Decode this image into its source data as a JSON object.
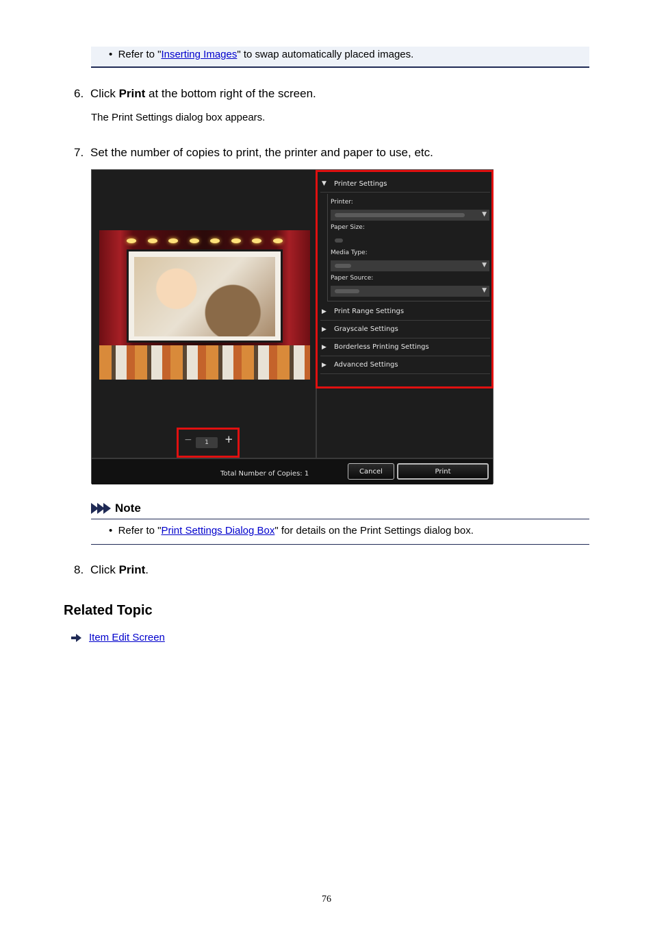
{
  "top_note": {
    "prefix": "Refer to \"",
    "link": "Inserting Images",
    "suffix": "\" to swap automatically placed images."
  },
  "step6": {
    "number": "6.",
    "before": "Click ",
    "bold": "Print",
    "after": " at the bottom right of the screen.",
    "result": "The Print Settings dialog box appears."
  },
  "step7": {
    "number": "7.",
    "text": "Set the number of copies to print, the printer and paper to use, etc."
  },
  "dialog": {
    "printer_settings_header": "Printer Settings",
    "printer_label": "Printer:",
    "paper_size_label": "Paper Size:",
    "media_type_label": "Media Type:",
    "paper_source_label": "Paper Source:",
    "sections": [
      "Print Range Settings",
      "Grayscale Settings",
      "Borderless Printing Settings",
      "Advanced Settings"
    ],
    "copies_value": "1",
    "minus": "−",
    "plus": "+",
    "total_label": "Total Number of Copies:  1",
    "cancel": "Cancel",
    "print": "Print",
    "highlight_color": "#e01010"
  },
  "note": {
    "title": "Note",
    "prefix": "Refer to \"",
    "link": "Print Settings Dialog Box",
    "suffix": "\" for details on the Print Settings dialog box."
  },
  "step8": {
    "number": "8.",
    "before": "Click ",
    "bold": "Print",
    "after": "."
  },
  "related": {
    "heading": "Related Topic",
    "link": "Item Edit Screen"
  },
  "page_number": "76"
}
